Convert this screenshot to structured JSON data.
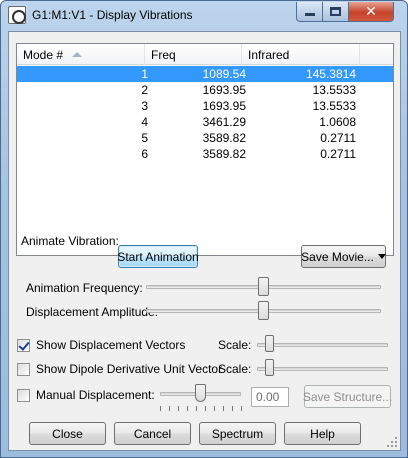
{
  "window": {
    "title": "G1:M1:V1 - Display Vibrations",
    "controls": {
      "minimize": "minimize",
      "maximize": "maximize",
      "close": "✕"
    }
  },
  "modes_table": {
    "columns": [
      "Mode #",
      "Freq",
      "Infrared"
    ],
    "rows": [
      {
        "mode": "1",
        "freq": "1089.54",
        "infrared": "145.3814",
        "selected": true
      },
      {
        "mode": "2",
        "freq": "1693.95",
        "infrared": "13.5533",
        "selected": false
      },
      {
        "mode": "3",
        "freq": "1693.95",
        "infrared": "13.5533",
        "selected": false
      },
      {
        "mode": "4",
        "freq": "3461.29",
        "infrared": "1.0608",
        "selected": false
      },
      {
        "mode": "5",
        "freq": "3589.82",
        "infrared": "0.2711",
        "selected": false
      },
      {
        "mode": "6",
        "freq": "3589.82",
        "infrared": "0.2711",
        "selected": false
      }
    ]
  },
  "animate": {
    "group_label": "Animate Vibration:",
    "start_button": "Start Animation",
    "save_movie_button": "Save Movie...",
    "frequency_label": "Animation Frequency:",
    "frequency_level": 0.5,
    "amplitude_label": "Displacement Amplitude:",
    "amplitude_level": 0.5
  },
  "options": {
    "show_vectors_label": "Show Displacement Vectors",
    "show_vectors_checked": true,
    "vectors_scale_label": "Scale:",
    "show_dipole_label": "Show Dipole Derivative Unit Vector",
    "show_dipole_checked": false,
    "dipole_scale_label": "Scale:",
    "manual_label": "Manual Displacement:",
    "manual_checked": false,
    "manual_value": "0.00",
    "save_structure_button": "Save Structure..."
  },
  "footer": {
    "close": "Close",
    "cancel": "Cancel",
    "spectrum": "Spectrum",
    "help": "Help"
  },
  "colors": {
    "selection": "#3399ff",
    "close_button": "#c4432a"
  }
}
